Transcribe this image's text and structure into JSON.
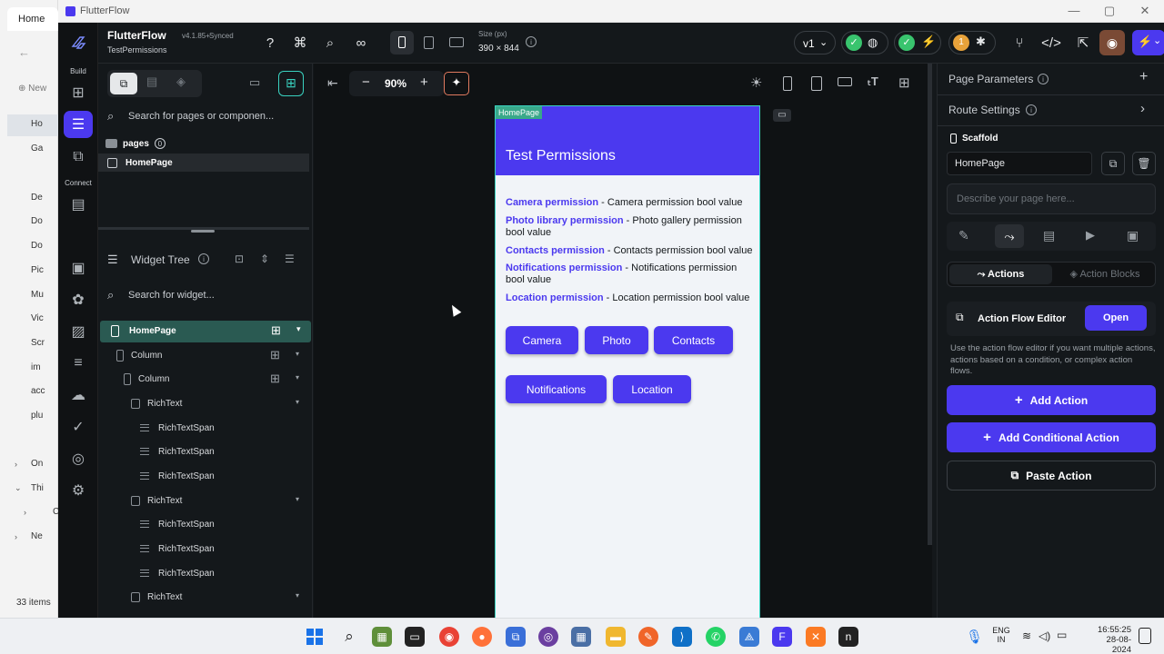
{
  "explorer": {
    "tab": "Home",
    "new_label": "New",
    "items": [
      "Ho",
      "Ga",
      "De",
      "Do",
      "Do",
      "Pic",
      "Mu",
      "Vic",
      "Scr",
      "im",
      "acc",
      "plu",
      "On",
      "Thi",
      "C",
      "Ne"
    ],
    "count": "33 items"
  },
  "window": {
    "title": "FlutterFlow"
  },
  "rail": {
    "build_label": "Build",
    "connect_label": "Connect"
  },
  "topbar": {
    "app_name": "FlutterFlow",
    "version": "v4.1.85+",
    "sync_status": "Synced",
    "project": "TestPermissions",
    "size_label": "Size (px)",
    "size_value": "390 × 844",
    "branch": "v1",
    "badge_count": "1"
  },
  "left_panel": {
    "search_placeholder": "Search for pages or componen...",
    "pages_label": "pages",
    "pages_count": "0",
    "page_item": "HomePage",
    "widget_tree_title": "Widget Tree",
    "widget_search_placeholder": "Search for widget...",
    "tree": [
      {
        "label": "HomePage"
      },
      {
        "label": "Column"
      },
      {
        "label": "Column"
      },
      {
        "label": "RichText"
      },
      {
        "label": "RichTextSpan"
      },
      {
        "label": "RichTextSpan"
      },
      {
        "label": "RichTextSpan"
      },
      {
        "label": "RichText"
      },
      {
        "label": "RichTextSpan"
      },
      {
        "label": "RichTextSpan"
      },
      {
        "label": "RichTextSpan"
      },
      {
        "label": "RichText"
      }
    ]
  },
  "canvas": {
    "zoom": "90%",
    "page_tag": "HomePage",
    "app_title": "Test Permissions",
    "permissions": [
      {
        "name": "Camera permission",
        "desc": " - Camera permission bool value"
      },
      {
        "name": "Photo library permission",
        "desc": " - Photo gallery permission bool value"
      },
      {
        "name": "Contacts permission",
        "desc": " - Contacts permission bool value"
      },
      {
        "name": "Notifications permission",
        "desc": " - Notifications permission bool value"
      },
      {
        "name": "Location permission",
        "desc": " - Location permission bool value"
      }
    ],
    "buttons": [
      "Camera",
      "Photo",
      "Contacts",
      "Notifications",
      "Location"
    ]
  },
  "right_panel": {
    "page_parameters": "Page Parameters",
    "route_settings": "Route Settings",
    "scaffold_label": "Scaffold",
    "page_name": "HomePage",
    "description_placeholder": "Describe your page here...",
    "tab_actions": "Actions",
    "tab_action_blocks": "Action Blocks",
    "editor_label": "Action Flow Editor",
    "open_label": "Open",
    "help_text": "Use the action flow editor if you want multiple actions, actions based on a condition, or complex action flows.",
    "add_action": "Add Action",
    "add_conditional": "Add Conditional Action",
    "paste_action": "Paste Action"
  },
  "taskbar": {
    "lang_top": "ENG",
    "lang_bottom": "IN",
    "time": "16:55:25",
    "date": "28-08-2024"
  },
  "colors": {
    "primary": "#4b39ef",
    "accent_teal": "#39d2c0",
    "panel_bg": "#14181b",
    "page_bg": "#f1f4f8"
  }
}
